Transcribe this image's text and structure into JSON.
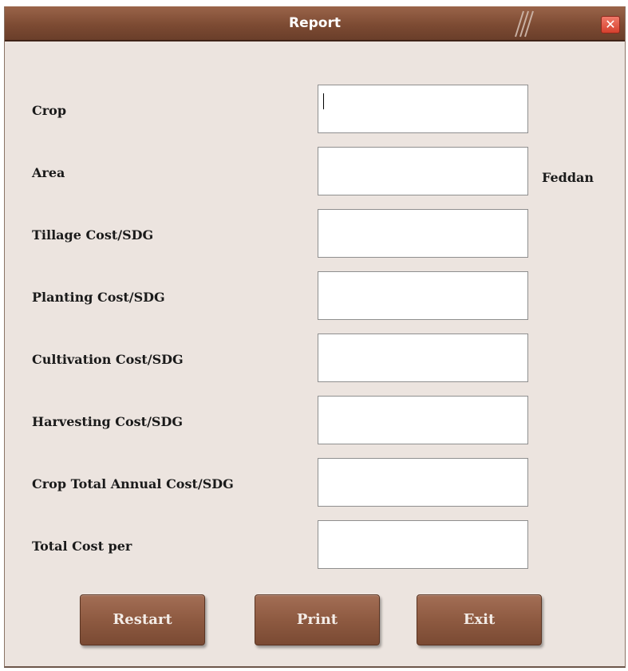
{
  "window": {
    "title": "Report",
    "close_icon": "close-icon"
  },
  "form": {
    "fields": [
      {
        "label": "Crop",
        "value": ""
      },
      {
        "label": "Area",
        "value": "",
        "unit": "Feddan"
      },
      {
        "label": "Tillage Cost/SDG",
        "value": ""
      },
      {
        "label": "Planting Cost/SDG",
        "value": ""
      },
      {
        "label": "Cultivation Cost/SDG",
        "value": ""
      },
      {
        "label": "Harvesting Cost/SDG",
        "value": ""
      },
      {
        "label": "Crop Total Annual Cost/SDG",
        "value": ""
      },
      {
        "label": "Total Cost per",
        "value": ""
      }
    ]
  },
  "buttons": {
    "restart": "Restart",
    "print": "Print",
    "exit": "Exit"
  },
  "colors": {
    "titlebar": "#7d4b33",
    "window_bg": "#ece4df",
    "button": "#8e5a41",
    "close": "#d6402d"
  }
}
